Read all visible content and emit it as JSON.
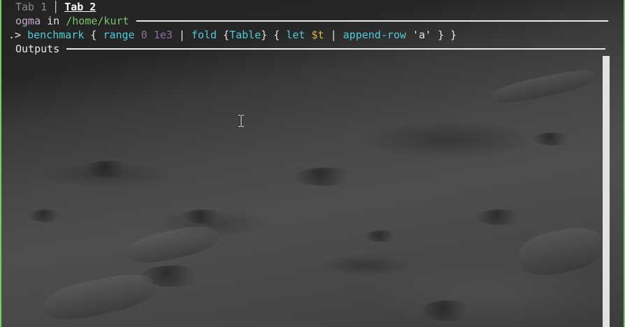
{
  "tabs": [
    {
      "label": "Tab 1",
      "active": false
    },
    {
      "label": "Tab 2",
      "active": true
    }
  ],
  "prompt": {
    "user": "ogma",
    "in_word": " in ",
    "path": "/home/kurt"
  },
  "command": {
    "prefix": ".> ",
    "tokens": [
      {
        "text": "benchmark",
        "kind": "fn"
      },
      {
        "text": " { ",
        "kind": "punct"
      },
      {
        "text": "range",
        "kind": "fn"
      },
      {
        "text": " ",
        "kind": "punct"
      },
      {
        "text": "0",
        "kind": "num"
      },
      {
        "text": " ",
        "kind": "punct"
      },
      {
        "text": "1e3",
        "kind": "num"
      },
      {
        "text": " | ",
        "kind": "punct"
      },
      {
        "text": "fold",
        "kind": "fn"
      },
      {
        "text": " {",
        "kind": "punct"
      },
      {
        "text": "Table",
        "kind": "type"
      },
      {
        "text": "} { ",
        "kind": "punct"
      },
      {
        "text": "let",
        "kind": "fn"
      },
      {
        "text": " ",
        "kind": "punct"
      },
      {
        "text": "$t",
        "kind": "var"
      },
      {
        "text": " | ",
        "kind": "punct"
      },
      {
        "text": "append-row",
        "kind": "fn"
      },
      {
        "text": " 'a' } }",
        "kind": "str"
      }
    ]
  },
  "outputs": {
    "label": "Outputs"
  },
  "colors": {
    "frame_accent": "#6fd25a",
    "function": "#4ec9d6",
    "number": "#8e6fa0",
    "variable": "#d7b944",
    "path": "#79c46b",
    "user": "#c3a9c9"
  },
  "icons": {
    "cursor": "text-cursor-ibeam-icon"
  }
}
